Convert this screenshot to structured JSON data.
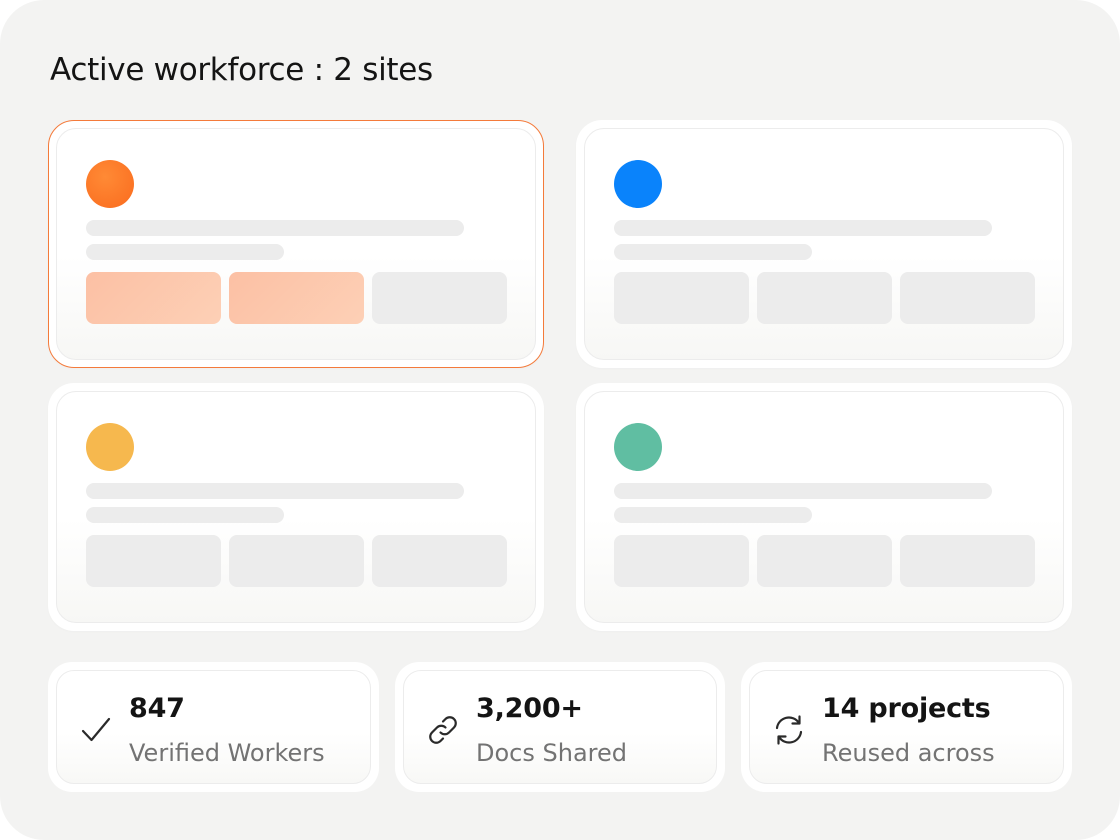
{
  "header": {
    "title": "Active workforce : 2 sites"
  },
  "sites": [
    {
      "accent": "#fd7928",
      "selected": true
    },
    {
      "accent": "#0a83fb",
      "selected": false
    },
    {
      "accent": "#f6b84e",
      "selected": false
    },
    {
      "accent": "#60bea2",
      "selected": false
    }
  ],
  "colors": {
    "selection_border": "#f47a3a",
    "highlight_chip": "#fdc4a8",
    "skeleton": "#ececec"
  },
  "stats": [
    {
      "value": "847",
      "label": "Verified Workers",
      "icon": "checkmark-icon"
    },
    {
      "value": "3,200+",
      "label": "Docs Shared",
      "icon": "link-icon"
    },
    {
      "value": "14 projects",
      "label": "Reused across",
      "icon": "refresh-icon"
    }
  ]
}
